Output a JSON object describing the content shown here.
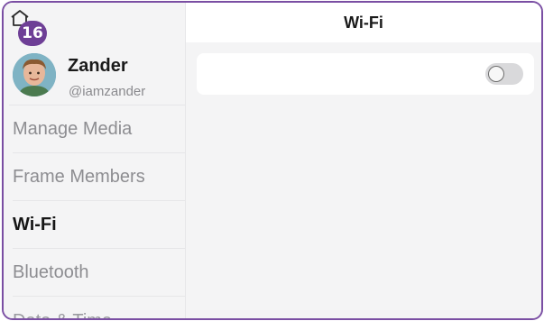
{
  "badge": {
    "count": "16"
  },
  "profile": {
    "name": "Zander",
    "handle": "@iamzander"
  },
  "sidebar": {
    "items": [
      {
        "label": "Manage Media",
        "active": false
      },
      {
        "label": "Frame Members",
        "active": false
      },
      {
        "label": "Wi-Fi",
        "active": true
      },
      {
        "label": "Bluetooth",
        "active": false
      },
      {
        "label": "Date & Time",
        "active": false
      }
    ]
  },
  "main": {
    "title": "Wi-Fi",
    "wifi_toggle": {
      "on": false
    }
  },
  "colors": {
    "accent": "#6e3f96",
    "border": "#7a4ea3"
  }
}
